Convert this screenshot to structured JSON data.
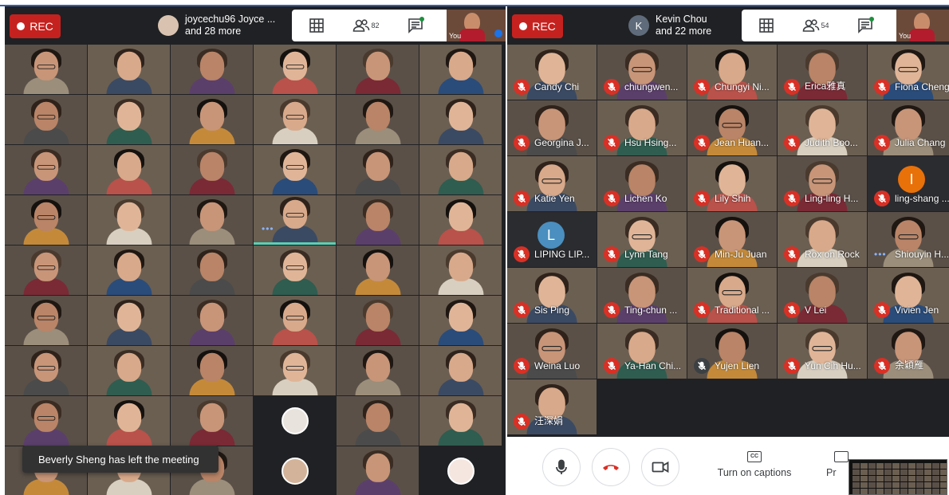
{
  "left_window": {
    "rec_label": "REC",
    "presenter_line1": "joycechu96 Joyce ...",
    "presenter_line2": "and 28 more",
    "participant_count": "82",
    "self_label": "You"
  },
  "right_window": {
    "rec_label": "REC",
    "presenter_initial": "K",
    "presenter_line1": "Kevin Chou",
    "presenter_line2": "and 22 more",
    "participant_count": "54",
    "self_label": "You"
  },
  "left_avatars": [
    {
      "col": 3,
      "row": 7,
      "kind": "bunny"
    },
    {
      "col": 3,
      "row": 8,
      "kind": "person"
    },
    {
      "col": 5,
      "row": 8,
      "kind": "flower"
    }
  ],
  "toast": {
    "text": "Beverly Sheng has left the meeting"
  },
  "right_participants": [
    {
      "name": "Candy Chi"
    },
    {
      "name": "chiungwen..."
    },
    {
      "name": "Chungyi Ni..."
    },
    {
      "name": "Erica雅真"
    },
    {
      "name": "Fiona Cheng"
    },
    {
      "name": "Georgina J..."
    },
    {
      "name": "Hsu Hsing..."
    },
    {
      "name": "Jean Huan..."
    },
    {
      "name": "Judith Boo..."
    },
    {
      "name": "Julia Chang"
    },
    {
      "name": "Katie Yen"
    },
    {
      "name": "Lichen Ko"
    },
    {
      "name": "Lily Shih"
    },
    {
      "name": "Ling-ling H..."
    },
    {
      "name": "ling-shang ...",
      "avatar": "I",
      "avatar_color": "#e8710a"
    },
    {
      "name": "LIPING LIP...",
      "avatar": "L",
      "avatar_color": "#4a8fbf"
    },
    {
      "name": "Lynn Tang"
    },
    {
      "name": "Min-Ju Juan"
    },
    {
      "name": "Rox on Rock"
    },
    {
      "name": "Shiouyin H...",
      "speaking": true
    },
    {
      "name": "Sis Ping"
    },
    {
      "name": "Ting-chun ..."
    },
    {
      "name": "Traditional ..."
    },
    {
      "name": "V Lei"
    },
    {
      "name": "Vivien Jen"
    },
    {
      "name": "Weina Luo"
    },
    {
      "name": "Ya-Han Chi..."
    },
    {
      "name": "Yujen Lien",
      "unmuted": true
    },
    {
      "name": "Yun Cih Hu..."
    },
    {
      "name": "余穎雁"
    },
    {
      "name": "汪深娟"
    }
  ],
  "bottom_bar": {
    "captions_label": "Turn on captions",
    "present_label": "Pr",
    "cc_text": "CC"
  },
  "colors": {
    "rec_red": "#c5221f",
    "mute_red": "#d93025",
    "dark_bg": "#202124",
    "accent_blue": "#1a73e8"
  }
}
